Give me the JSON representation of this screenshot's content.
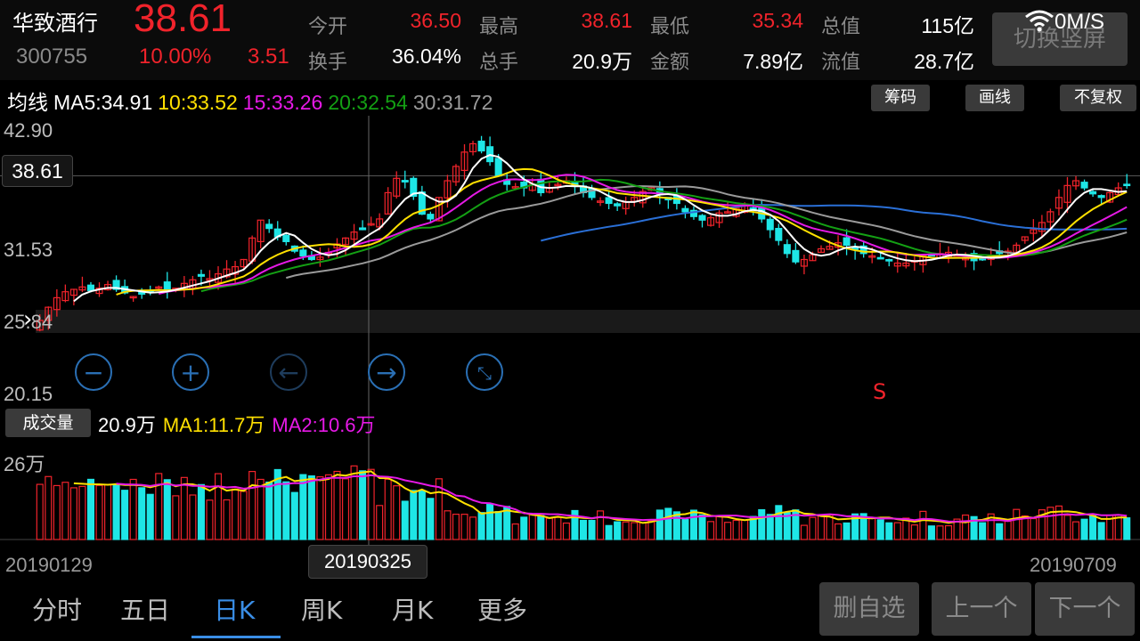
{
  "stock": {
    "name": "华致酒行",
    "code": "300755",
    "price": "38.61",
    "change_pct": "10.00%",
    "change": "3.51"
  },
  "quote": {
    "row1": [
      {
        "label": "今开",
        "value": "36.50",
        "color": "red"
      },
      {
        "label": "最高",
        "value": "38.61",
        "color": "red"
      },
      {
        "label": "最低",
        "value": "35.34",
        "color": "red"
      },
      {
        "label": "总值",
        "value": "115亿",
        "color": "white"
      }
    ],
    "row2": [
      {
        "label": "换手",
        "value": "36.04%",
        "color": "white"
      },
      {
        "label": "总手",
        "value": "20.9万",
        "color": "white"
      },
      {
        "label": "金额",
        "value": "7.89亿",
        "color": "white"
      },
      {
        "label": "流值",
        "value": "28.7亿",
        "color": "white"
      }
    ]
  },
  "switch_button": "切换竖屏",
  "network": {
    "speed": "0M/S",
    "icon": "wifi-icon"
  },
  "ma": {
    "label": "均线",
    "items": [
      {
        "text": "MA5:34.91",
        "color": "#ffffff"
      },
      {
        "text": "10:33.52",
        "color": "#ffe000"
      },
      {
        "text": "15:33.26",
        "color": "#e619e6"
      },
      {
        "text": "20:32.54",
        "color": "#14a014"
      },
      {
        "text": "30:31.72",
        "color": "#9a9a9a"
      }
    ]
  },
  "toolbar": {
    "chips_label": "筹码",
    "draw_label": "画线",
    "adjust_label": "不复权"
  },
  "price_axis": {
    "top": "42.90",
    "current": "38.61",
    "mid": "31.53",
    "low": "25.84",
    "bottom": "20.15"
  },
  "signal_marker": "S",
  "volume": {
    "button": "成交量",
    "current": "20.9万",
    "ma1": "MA1:11.7万",
    "ma2": "MA2:10.6万",
    "axis_top": "26万"
  },
  "dates": {
    "start": "20190129",
    "cursor": "20190325",
    "end": "20190709"
  },
  "tabs": [
    {
      "label": "分时",
      "active": false
    },
    {
      "label": "五日",
      "active": false
    },
    {
      "label": "日K",
      "active": true
    },
    {
      "label": "周K",
      "active": false
    },
    {
      "label": "月K",
      "active": false
    },
    {
      "label": "更多",
      "active": false
    }
  ],
  "buttons": {
    "delete_watch": "删自选",
    "prev": "上一个",
    "next": "下一个"
  },
  "colors": {
    "up": "#f0232b",
    "down": "#1ee6e6",
    "accent": "#3a8ee6"
  },
  "chart_data": {
    "type": "candlestick",
    "price_range": [
      20.15,
      42.9
    ],
    "closes": [
      26.5,
      27.6,
      28.4,
      28.9,
      29.1,
      29.3,
      29.0,
      29.2,
      29.5,
      29.1,
      28.8,
      28.5,
      28.7,
      29.0,
      29.3,
      29.1,
      29.2,
      29.6,
      29.9,
      30.2,
      30.0,
      30.4,
      30.8,
      31.0,
      31.6,
      33.4,
      34.9,
      34.2,
      33.5,
      33.1,
      32.3,
      31.9,
      31.6,
      31.8,
      32.2,
      32.9,
      33.4,
      33.9,
      34.1,
      34.6,
      35.0,
      37.2,
      38.4,
      38.1,
      36.9,
      35.4,
      35.0,
      36.8,
      38.2,
      39.4,
      40.6,
      41.3,
      40.7,
      39.8,
      38.6,
      37.9,
      37.7,
      37.6,
      37.9,
      37.2,
      37.6,
      37.9,
      38.2,
      37.8,
      37.2,
      36.8,
      36.5,
      36.3,
      36.1,
      36.4,
      36.8,
      37.3,
      37.6,
      37.1,
      36.6,
      36.3,
      35.6,
      35.2,
      34.9,
      35.1,
      35.5,
      35.6,
      35.9,
      36.1,
      35.7,
      35.0,
      34.1,
      33.2,
      32.1,
      31.4,
      31.6,
      32.0,
      32.5,
      32.7,
      33.0,
      32.8,
      32.4,
      32.1,
      31.9,
      31.7,
      31.5,
      31.3,
      31.3,
      31.5,
      31.9,
      31.9,
      32.1,
      32.2,
      32.0,
      31.7,
      31.5,
      31.6,
      31.9,
      32.1,
      32.3,
      32.8,
      33.5,
      34.1,
      34.7,
      35.6,
      36.8,
      37.8,
      38.2,
      37.6,
      37.1,
      36.8,
      37.2,
      37.6,
      37.9
    ],
    "ma5_last": 34.91,
    "ma10_last": 33.52,
    "ma15_last": 33.26,
    "ma20_last": 32.54,
    "ma30_last": 31.72,
    "volume_unit": "万",
    "volume_max": 26,
    "vol_ma1_last": 11.7,
    "vol_ma2_last": 10.6
  }
}
